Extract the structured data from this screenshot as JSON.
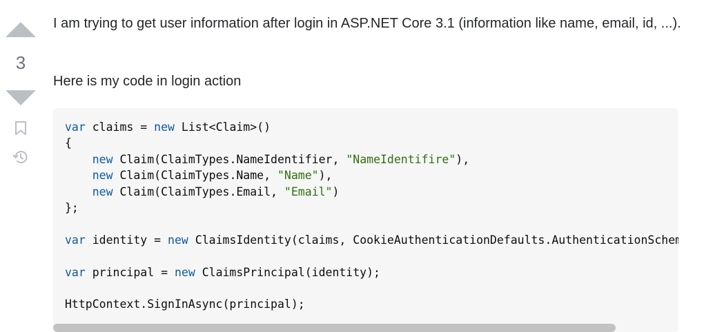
{
  "vote": {
    "count": "3",
    "up_icon": "triangle-up-icon",
    "down_icon": "triangle-down-icon",
    "bookmark_icon": "bookmark-icon",
    "history_icon": "history-icon",
    "icon_color": "#babfc4"
  },
  "post": {
    "paragraph1": "I am trying to get user information after login in ASP.NET Core 3.1 (information like name, email, id, ...).",
    "paragraph2": "Here is my code in login action"
  },
  "code": {
    "line1": {
      "kw": "var",
      "rest1": " claims = ",
      "kw2": "new",
      "rest2": " List<Claim>()"
    },
    "line2": "{",
    "line3": {
      "indent": "    ",
      "kw": "new",
      "pre": " Claim(ClaimTypes.NameIdentifier, ",
      "str": "\"NameIdentifire\"",
      "post": "),"
    },
    "line4": {
      "indent": "    ",
      "kw": "new",
      "pre": " Claim(ClaimTypes.Name, ",
      "str": "\"Name\"",
      "post": "),"
    },
    "line5": {
      "indent": "    ",
      "kw": "new",
      "pre": " Claim(ClaimTypes.Email, ",
      "str": "\"Email\"",
      "post": ")"
    },
    "line6": "};",
    "line8": {
      "kw": "var",
      "rest1": " identity = ",
      "kw2": "new",
      "rest2": " ClaimsIdentity(claims, CookieAuthenticationDefaults.AuthenticationScheme);"
    },
    "line10": {
      "kw": "var",
      "rest1": " principal = ",
      "kw2": "new",
      "rest2": " ClaimsPrincipal(identity);"
    },
    "line12": "HttpContext.SignInAsync(principal);",
    "keyword_color": "#0c5a9b",
    "string_color": "#2f6f10",
    "background": "#f6f6f6"
  }
}
